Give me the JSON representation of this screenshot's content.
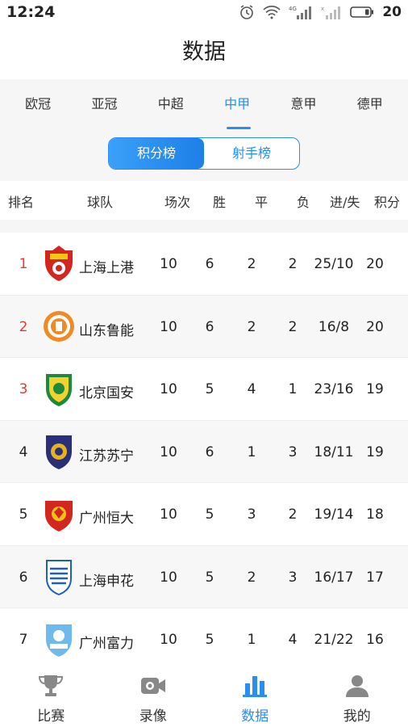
{
  "status_bar": {
    "time": "12:24",
    "battery": "20"
  },
  "page_title": "数据",
  "league_tabs": [
    "欧冠",
    "亚冠",
    "中超",
    "中甲",
    "意甲",
    "德甲"
  ],
  "active_league": "中甲",
  "segments": {
    "standings": "积分榜",
    "scorers": "射手榜"
  },
  "table_headers": {
    "rank": "排名",
    "team": "球队",
    "played": "场次",
    "win": "胜",
    "draw": "平",
    "loss": "负",
    "goals": "进/失",
    "points": "积分"
  },
  "rows": [
    {
      "rank": "1",
      "team": "上海上港",
      "played": "10",
      "win": "6",
      "draw": "2",
      "loss": "2",
      "goals": "25/10",
      "points": "20"
    },
    {
      "rank": "2",
      "team": "山东鲁能",
      "played": "10",
      "win": "6",
      "draw": "2",
      "loss": "2",
      "goals": "16/8",
      "points": "20"
    },
    {
      "rank": "3",
      "team": "北京国安",
      "played": "10",
      "win": "5",
      "draw": "4",
      "loss": "1",
      "goals": "23/16",
      "points": "19"
    },
    {
      "rank": "4",
      "team": "江苏苏宁",
      "played": "10",
      "win": "6",
      "draw": "1",
      "loss": "3",
      "goals": "18/11",
      "points": "19"
    },
    {
      "rank": "5",
      "team": "广州恒大",
      "played": "10",
      "win": "5",
      "draw": "3",
      "loss": "2",
      "goals": "19/14",
      "points": "18"
    },
    {
      "rank": "6",
      "team": "上海申花",
      "played": "10",
      "win": "5",
      "draw": "2",
      "loss": "3",
      "goals": "16/17",
      "points": "17"
    },
    {
      "rank": "7",
      "team": "广州富力",
      "played": "10",
      "win": "5",
      "draw": "1",
      "loss": "4",
      "goals": "21/22",
      "points": "16"
    }
  ],
  "bottom_nav": {
    "match": "比赛",
    "video": "录像",
    "data": "数据",
    "mine": "我的"
  },
  "colors": {
    "accent": "#2a8ef0",
    "top3_rank": "#e53935"
  }
}
